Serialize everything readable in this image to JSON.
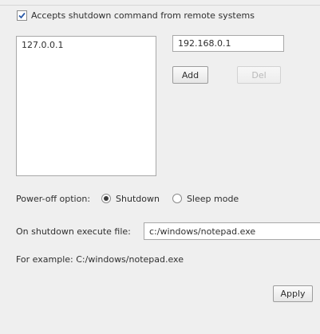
{
  "remote": {
    "checkbox_label": "Accepts shutdown command from remote systems",
    "checked": true,
    "list_items": [
      "127.0.0.1"
    ],
    "ip_input_value": "192.168.0.1",
    "add_label": "Add",
    "del_label": "Del"
  },
  "power": {
    "label": "Power-off option:",
    "options": [
      {
        "label": "Shutdown",
        "selected": true
      },
      {
        "label": "Sleep mode",
        "selected": false
      }
    ]
  },
  "exec": {
    "label": "On shutdown execute file:",
    "value": "c:/windows/notepad.exe",
    "example": "For example: C:/windows/notepad.exe"
  },
  "apply_label": "Apply"
}
